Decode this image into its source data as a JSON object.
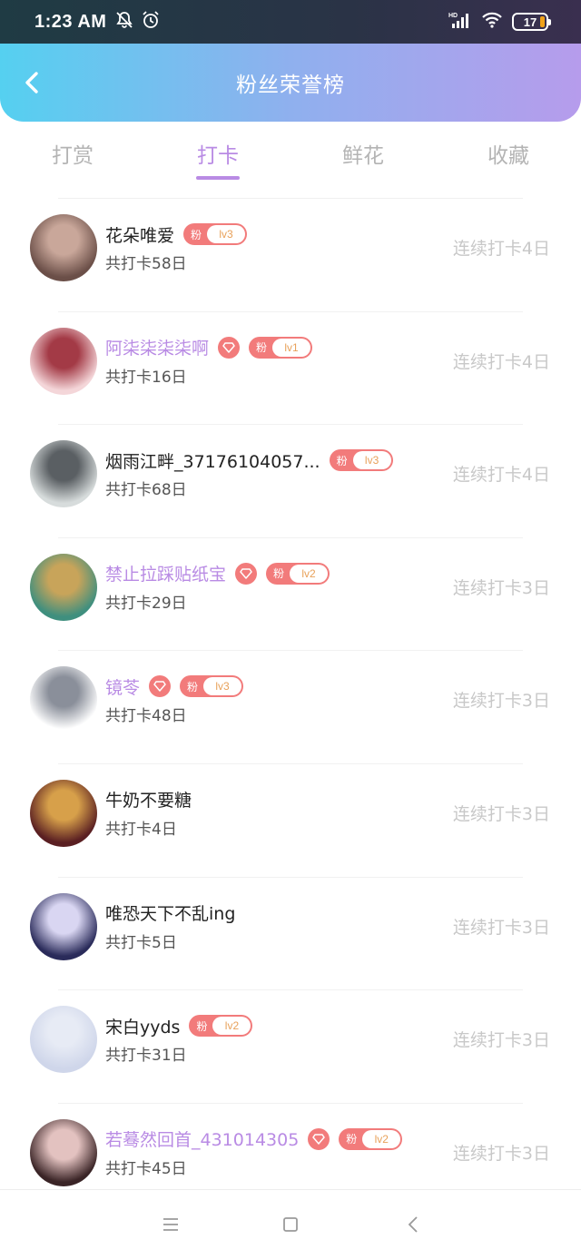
{
  "status": {
    "time": "1:23 AM",
    "battery": "17"
  },
  "header": {
    "title": "粉丝荣誉榜"
  },
  "tabs": [
    {
      "label": "打赏",
      "active": false
    },
    {
      "label": "打卡",
      "active": true
    },
    {
      "label": "鲜花",
      "active": false
    },
    {
      "label": "收藏",
      "active": false
    }
  ],
  "fan_badge_text": "粉",
  "rows": [
    {
      "name": "花朵唯爱",
      "vip": false,
      "gem": false,
      "level": "lv3",
      "total": "共打卡58日",
      "streak": "连续打卡4日",
      "avatar_colors": [
        "#6b4f48",
        "#c9a79a"
      ]
    },
    {
      "name": "阿柒柒柒柒啊",
      "vip": true,
      "gem": true,
      "level": "lv1",
      "total": "共打卡16日",
      "streak": "连续打卡4日",
      "avatar_colors": [
        "#f4d6d9",
        "#a33a46"
      ]
    },
    {
      "name": "烟雨江畔_37176104057...",
      "vip": false,
      "gem": false,
      "level": "lv3",
      "total": "共打卡68日",
      "streak": "连续打卡4日",
      "avatar_colors": [
        "#d7dcdc",
        "#5a5f63"
      ]
    },
    {
      "name": "禁止拉踩贴纸宝",
      "vip": true,
      "gem": true,
      "level": "lv2",
      "total": "共打卡29日",
      "streak": "连续打卡3日",
      "avatar_colors": [
        "#3f8f7e",
        "#c8a45a"
      ]
    },
    {
      "name": "镜苓",
      "vip": true,
      "gem": true,
      "level": "lv3",
      "total": "共打卡48日",
      "streak": "连续打卡3日",
      "avatar_colors": [
        "#ffffff",
        "#8a8f9a"
      ]
    },
    {
      "name": "牛奶不要糖",
      "vip": false,
      "gem": false,
      "level": null,
      "total": "共打卡4日",
      "streak": "连续打卡3日",
      "avatar_colors": [
        "#5a1f22",
        "#d7a04a"
      ]
    },
    {
      "name": "唯恐天下不乱ing",
      "vip": false,
      "gem": false,
      "level": null,
      "total": "共打卡5日",
      "streak": "连续打卡3日",
      "avatar_colors": [
        "#2a2b5a",
        "#d9d6f2"
      ]
    },
    {
      "name": "宋白yyds",
      "vip": false,
      "gem": false,
      "level": "lv2",
      "total": "共打卡31日",
      "streak": "连续打卡3日",
      "avatar_colors": [
        "#cfd6ea",
        "#e7ebf5"
      ]
    },
    {
      "name": "若蓦然回首_431014305",
      "vip": true,
      "gem": true,
      "level": "lv2",
      "total": "共打卡45日",
      "streak": "连续打卡3日",
      "avatar_colors": [
        "#3a2426",
        "#e3c2c0"
      ]
    }
  ]
}
